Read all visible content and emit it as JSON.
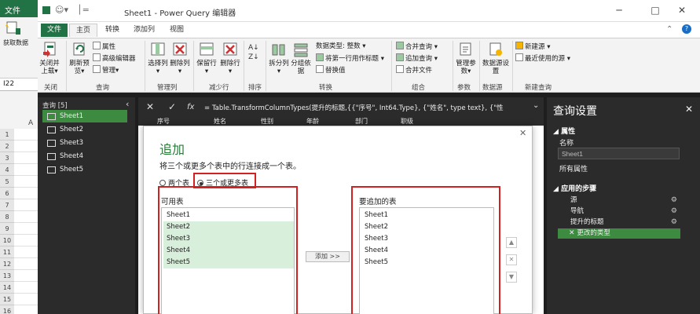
{
  "excel": {
    "file_tab": "文件",
    "get_data": "获取数据",
    "name_box": "I22",
    "col_a": "A",
    "rows": [
      "1",
      "2",
      "3",
      "4",
      "5",
      "6",
      "7",
      "8",
      "9",
      "10",
      "11",
      "12",
      "13",
      "14",
      "15",
      "16"
    ]
  },
  "window": {
    "title": "Sheet1 - Power Query 编辑器",
    "minimize": "─",
    "maximize": "□",
    "close": "✕"
  },
  "tabs": [
    "文件",
    "主页",
    "转换",
    "添加列",
    "视图"
  ],
  "ribbon": {
    "close_load": "关闭并上载▾",
    "refresh_preview": "刷新预览▾",
    "properties": "属性",
    "advanced_editor": "高级编辑器",
    "manage": "管理▾",
    "choose_cols": "选择列▾",
    "remove_cols": "删除列▾",
    "keep_rows": "保留行▾",
    "remove_rows": "删除行▾",
    "split_col": "拆分列▾",
    "group_by": "分组依据",
    "data_type": "数据类型: 整数 ▾",
    "first_row_header": "将第一行用作标题 ▾",
    "replace_values": "替换值",
    "merge_queries": "合并查询 ▾",
    "append_queries": "追加查询 ▾",
    "merge_files": "合并文件",
    "manage_params": "管理参数▾",
    "datasource_settings": "数据源设置",
    "new_source": "新建源 ▾",
    "recent_sources": "最近使用的源 ▾",
    "groups": {
      "close": "关闭",
      "query": "查询",
      "manage_cols": "管理列",
      "reduce_rows": "减少行",
      "sort": "排序",
      "transform": "转换",
      "combine": "组合",
      "params": "参数",
      "datasource": "数据源",
      "new_query": "新建查询"
    }
  },
  "queries": {
    "header": "查询 [5]",
    "items": [
      "Sheet1",
      "Sheet2",
      "Sheet3",
      "Sheet4",
      "Sheet5"
    ]
  },
  "formula": {
    "cancel": "✕",
    "confirm": "✓",
    "fx": "fx",
    "text": "= Table.TransformColumnTypes(提升的标题,{{\"序号\", Int64.Type}, {\"姓名\", type text}, {\"性"
  },
  "columns": [
    "序号",
    "姓名",
    "性别",
    "年龄",
    "部门",
    "职级"
  ],
  "settings": {
    "title": "查询设置",
    "properties_label": "属性",
    "name_label": "名称",
    "name_value": "Sheet1",
    "all_props": "所有属性",
    "steps_label": "应用的步骤",
    "steps": [
      "源",
      "导航",
      "提升的标题",
      "更改的类型"
    ]
  },
  "dialog": {
    "title": "追加",
    "description": "将三个或更多个表中的行连接成一个表。",
    "radio_two": "两个表",
    "radio_three": "三个或更多表",
    "available_label": "可用表",
    "available": [
      "Sheet1",
      "Sheet2",
      "Sheet3",
      "Sheet4",
      "Sheet5"
    ],
    "append_label": "要追加的表",
    "to_append": [
      "Sheet1",
      "Sheet2",
      "Sheet3",
      "Sheet4",
      "Sheet5"
    ],
    "add_button": "添加 >>",
    "close": "✕",
    "up_arrow": "▲",
    "remove_x": "✕",
    "down_arrow": "▼"
  },
  "colors": {
    "excel_green": "#217346",
    "accent_green": "#3d8b40",
    "highlight": "#d32020",
    "dark_panel": "#2b2b2b"
  }
}
